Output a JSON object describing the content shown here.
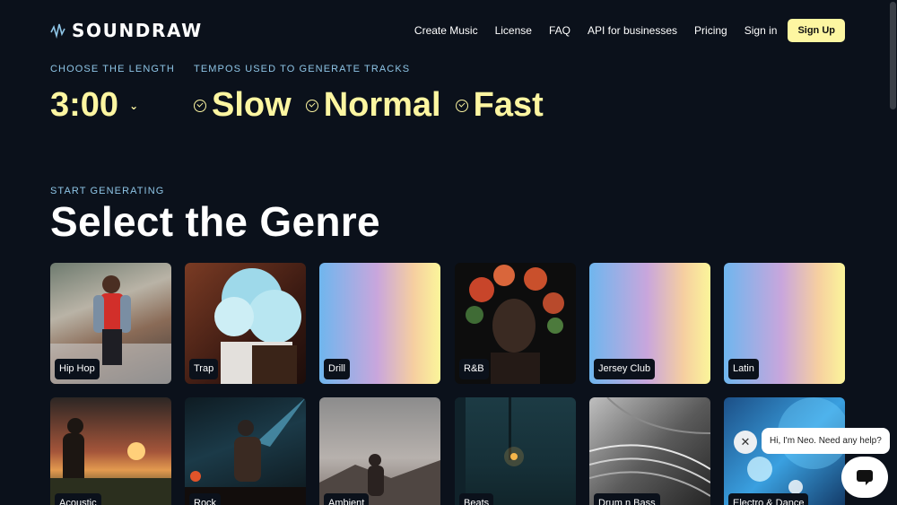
{
  "header": {
    "logo_text": "SOUNDRAW",
    "nav": [
      "Create Music",
      "License",
      "FAQ",
      "API for businesses",
      "Pricing",
      "Sign in"
    ],
    "signup_label": "Sign Up"
  },
  "length": {
    "eyebrow": "CHOOSE THE LENGTH",
    "value": "3:00"
  },
  "tempos": {
    "eyebrow": "TEMPOS USED TO GENERATE TRACKS",
    "items": [
      "Slow",
      "Normal",
      "Fast"
    ]
  },
  "genre": {
    "eyebrow": "START GENERATING",
    "title": "Select the Genre"
  },
  "genres": [
    {
      "label": "Hip Hop",
      "icon": "photo-person-red-hoodie"
    },
    {
      "label": "Trap",
      "icon": "photo-blue-smoke"
    },
    {
      "label": "Drill",
      "icon": "gradient"
    },
    {
      "label": "R&B",
      "icon": "photo-flower-crown"
    },
    {
      "label": "Jersey Club",
      "icon": "gradient"
    },
    {
      "label": "Latin",
      "icon": "gradient"
    },
    {
      "label": "Acoustic",
      "icon": "photo-sunset-guitarist"
    },
    {
      "label": "Rock",
      "icon": "photo-concert"
    },
    {
      "label": "Ambient",
      "icon": "photo-desert-woman"
    },
    {
      "label": "Beats",
      "icon": "photo-foggy-street"
    },
    {
      "label": "Drum n Bass",
      "icon": "photo-bw-architecture"
    },
    {
      "label": "Electro & Dance",
      "icon": "photo-blue-lights"
    }
  ],
  "chat": {
    "message": "Hi, I'm Neo. Need any help?"
  },
  "colors": {
    "background": "#0b111b",
    "accent": "#fdf6a1",
    "eyebrow": "#8ec5e6"
  }
}
